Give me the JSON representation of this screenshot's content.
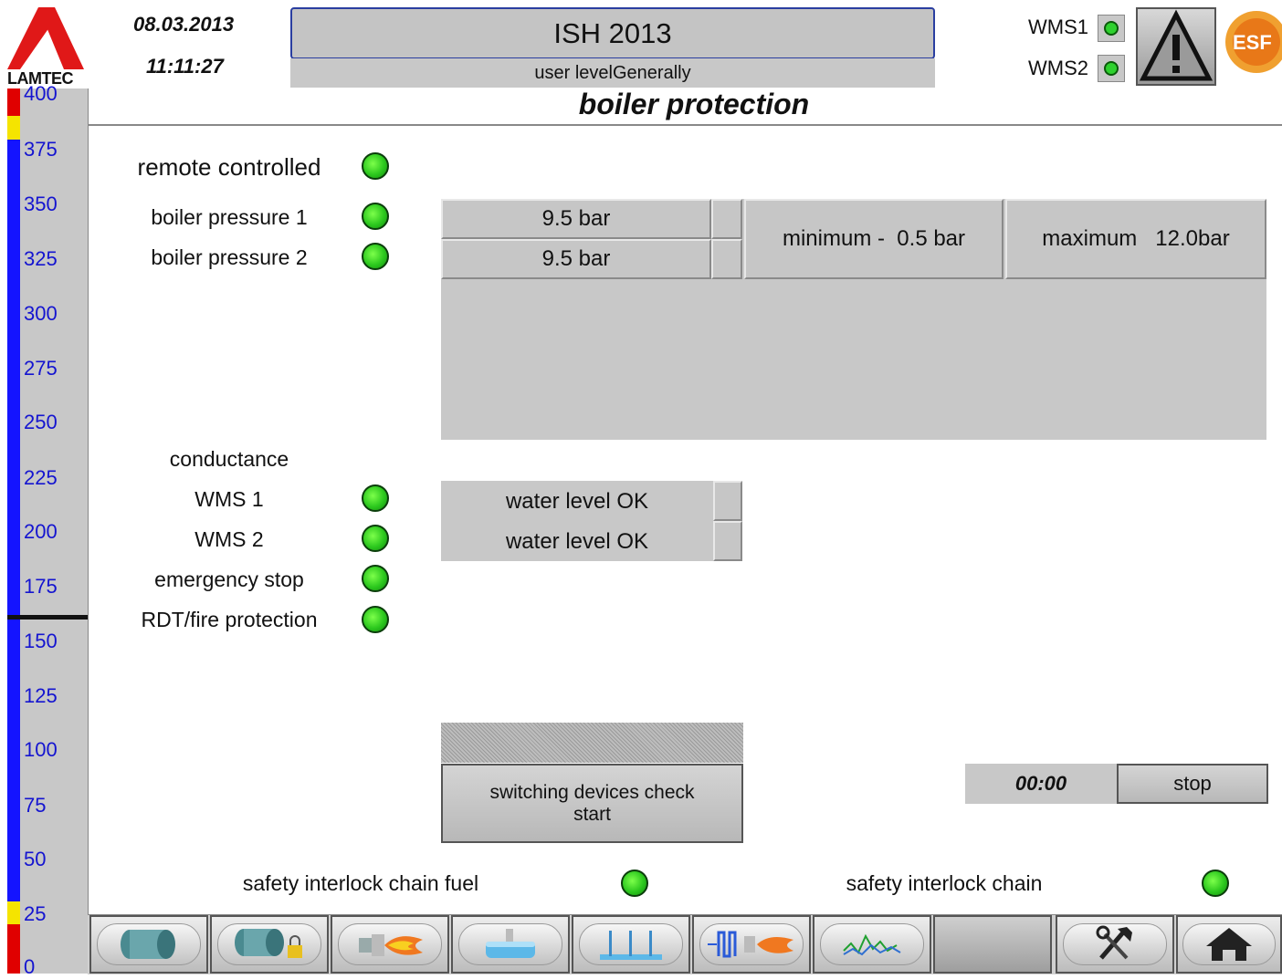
{
  "header": {
    "logo": "LAMTEC",
    "date": "08.03.2013",
    "time": "11:11:27",
    "title": "ISH 2013",
    "user_level": "user levelGenerally",
    "page_title": "boiler protection",
    "wms": [
      {
        "label": "WMS1",
        "status": "ok"
      },
      {
        "label": "WMS2",
        "status": "ok"
      }
    ],
    "brand_logo": "ESF"
  },
  "scale": {
    "labels": [
      "400",
      "375",
      "350",
      "325",
      "300",
      "275",
      "250",
      "225",
      "200",
      "175",
      "150",
      "125",
      "100",
      "75",
      "50",
      "25",
      "0"
    ],
    "marker_value": 150,
    "colors": {
      "bar": "#1414ff",
      "alarm": "#e00000",
      "warning": "#f5e400"
    }
  },
  "indicators": {
    "remote_controlled": "remote controlled",
    "boiler_pressure_1": "boiler pressure 1",
    "boiler_pressure_2": "boiler pressure 2",
    "conductance": "conductance",
    "wms_1": "WMS 1",
    "wms_2": "WMS 2",
    "emergency_stop": "emergency stop",
    "rdt_fire": "RDT/fire protection",
    "interlock_fuel": "safety interlock chain fuel",
    "interlock_chain": "safety interlock chain"
  },
  "pressure": {
    "value_1": "9.5 bar",
    "value_2": "9.5 bar",
    "minimum": "minimum -  0.5 bar",
    "maximum": "maximum   12.0bar"
  },
  "water_level": {
    "wms_1": "water level OK",
    "wms_2": "water level OK"
  },
  "switching": {
    "button_line1": "switching devices check",
    "button_line2": "start"
  },
  "timer": {
    "value": "00:00",
    "stop_label": "stop"
  },
  "nav_icons": [
    "boiler-icon",
    "boiler-lock-icon",
    "burner-icon",
    "tank-icon",
    "manifold-icon",
    "heat-exchanger-burner-icon",
    "trend-chart-icon",
    "blank",
    "tools-icon",
    "home-icon"
  ],
  "led_color": "#2ed12e"
}
